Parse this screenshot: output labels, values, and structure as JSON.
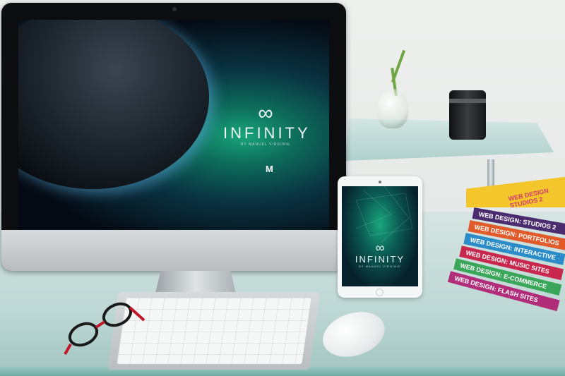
{
  "monitor_screen": {
    "logo_symbol": "∞",
    "title": "INFINITY",
    "subtitle": "BY MANUEL VIRGINIE",
    "badge": "M"
  },
  "tablet_screen": {
    "logo_symbol": "∞",
    "title": "INFINITY",
    "subtitle": "BY MANUEL VIRGINIE"
  },
  "books": {
    "cover_text": "WEB DESIGN STUDIOS 2",
    "spines": [
      {
        "label": "WEB DESIGN: STUDIOS 2",
        "color": "#4b2c6e"
      },
      {
        "label": "WEB DESIGN: PORTFOLIOS",
        "color": "#e05a2a"
      },
      {
        "label": "WEB DESIGN: INTERACTIVE",
        "color": "#2c8cc8"
      },
      {
        "label": "WEB DESIGN: MUSIC SITES",
        "color": "#c8284d"
      },
      {
        "label": "WEB DESIGN: E-COMMERCE",
        "color": "#3aa65a"
      },
      {
        "label": "WEB DESIGN: FLASH SITES",
        "color": "#b12d7a"
      }
    ]
  },
  "colors": {
    "nebula_green": "#18a67a",
    "space_dark": "#050b14",
    "glass_tint": "#a9d2cc",
    "glasses_red": "#c01828"
  },
  "icons": {
    "monitor_camera": "camera-dot-icon",
    "tablet_home": "home-button-icon"
  }
}
